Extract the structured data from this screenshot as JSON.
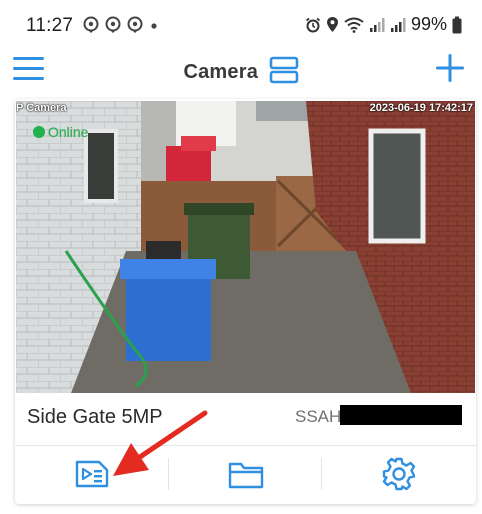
{
  "status_bar": {
    "time": "11:27",
    "battery": "99%",
    "icons": [
      "location-pin-icon",
      "location-pin-icon",
      "location-pin-icon",
      "dot-icon",
      "alarm-icon",
      "location-icon",
      "wifi-icon",
      "signal-icon",
      "signal-icon",
      "battery-icon"
    ]
  },
  "header": {
    "title": "Camera",
    "menu_icon": "hamburger-menu-icon",
    "layout_icon": "view-layout-icon",
    "add_icon": "plus-icon",
    "accent_color": "#2f8fe0"
  },
  "camera_card": {
    "overlay_label": "P Camera",
    "overlay_timestamp": "2023-06-19 17:42:17",
    "status": "Online",
    "status_color": "#21b24b",
    "name": "Side Gate 5MP",
    "serial_prefix": "SSAH",
    "actions": [
      {
        "name": "playback",
        "icon": "playback-list-icon"
      },
      {
        "name": "files",
        "icon": "folder-icon"
      },
      {
        "name": "settings",
        "icon": "gear-icon"
      }
    ]
  },
  "annotation": {
    "color": "#e32b22",
    "icon": "red-arrow-annotation"
  }
}
